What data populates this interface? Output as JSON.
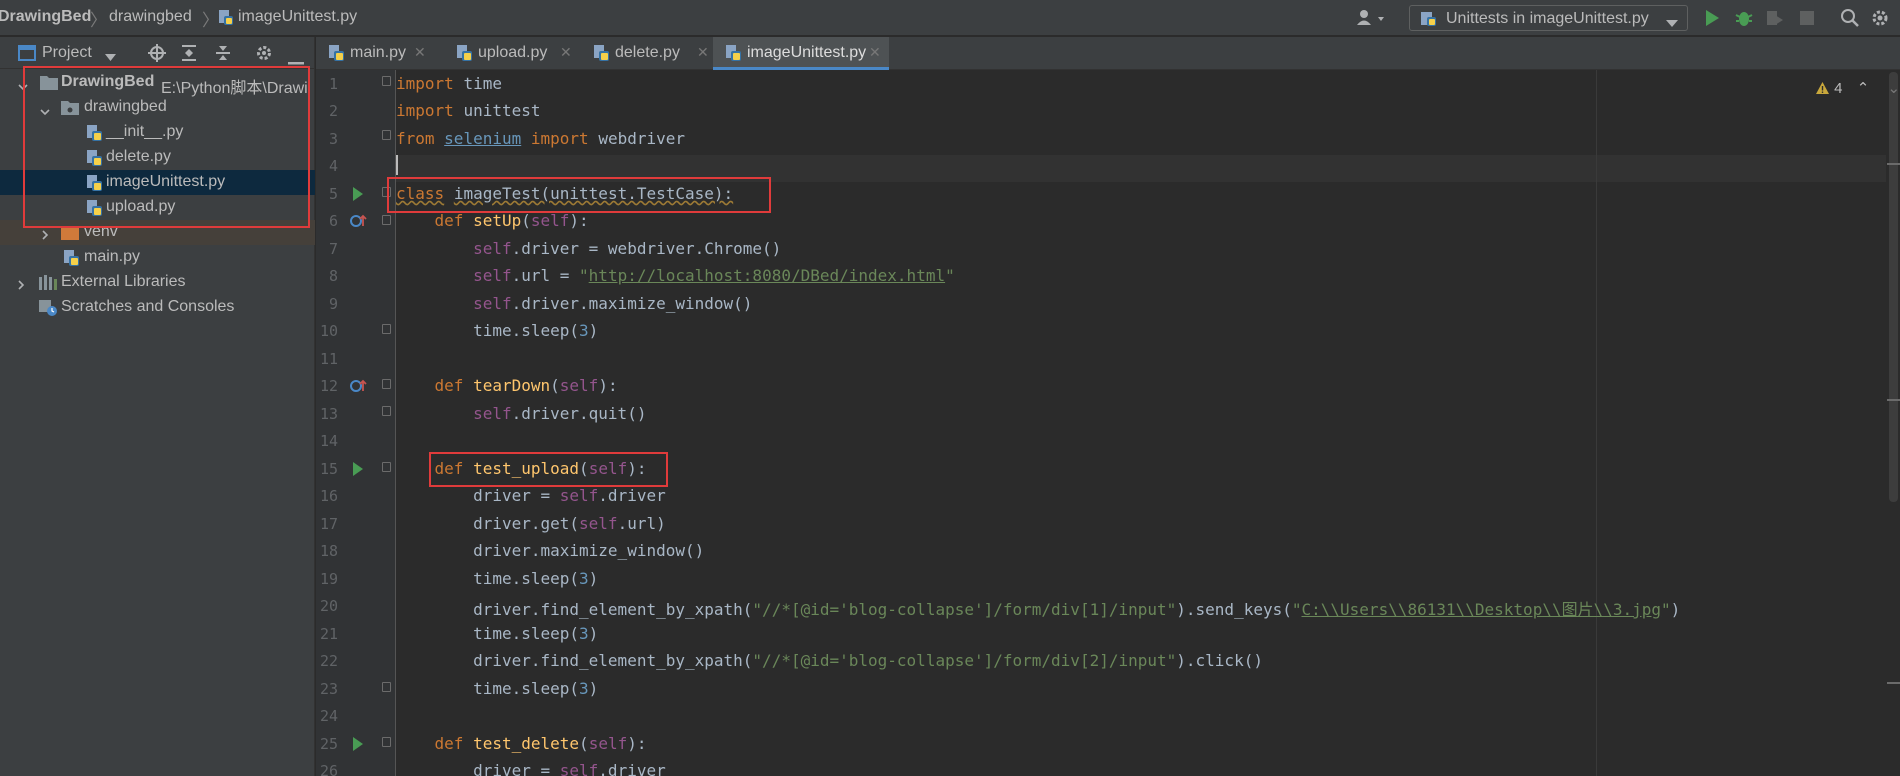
{
  "breadcrumb": {
    "project": "DrawingBed",
    "folder": "drawingbed",
    "file": "imageUnittest.py"
  },
  "run_config": {
    "label": "Unittests in imageUnittest.py"
  },
  "project_panel": {
    "title": "Project",
    "root": {
      "name": "DrawingBed",
      "path": "E:\\Python脚本\\Drawi"
    },
    "items": [
      {
        "label": "drawingbed"
      },
      {
        "label": "__init__.py"
      },
      {
        "label": "delete.py"
      },
      {
        "label": "imageUnittest.py"
      },
      {
        "label": "upload.py"
      },
      {
        "label": "venv"
      },
      {
        "label": "main.py"
      },
      {
        "label": "External Libraries"
      },
      {
        "label": "Scratches and Consoles"
      }
    ]
  },
  "tabs": [
    {
      "label": "main.py"
    },
    {
      "label": "upload.py"
    },
    {
      "label": "delete.py"
    },
    {
      "label": "imageUnittest.py"
    }
  ],
  "editor": {
    "warnings_count": "4",
    "line_numbers": [
      "1",
      "2",
      "3",
      "4",
      "5",
      "6",
      "7",
      "8",
      "9",
      "10",
      "11",
      "12",
      "13",
      "14",
      "15",
      "16",
      "17",
      "18",
      "19",
      "20",
      "21",
      "22",
      "23",
      "24",
      "25",
      "26"
    ],
    "lines": {
      "l1": "import time",
      "l2": "import unittest",
      "l3": "from selenium import webdriver",
      "l5": "class imageTest(unittest.TestCase):",
      "l6": "    def setUp(self):",
      "l7": "        self.driver = webdriver.Chrome()",
      "l8": "        self.url = \"http://localhost:8080/DBed/index.html\"",
      "l9": "        self.driver.maximize_window()",
      "l10": "        time.sleep(3)",
      "l12": "    def tearDown(self):",
      "l13": "        self.driver.quit()",
      "l15": "    def test_upload(self):",
      "l16": "        driver = self.driver",
      "l17": "        driver.get(self.url)",
      "l18": "        driver.maximize_window()",
      "l19": "        time.sleep(3)",
      "l20": "        driver.find_element_by_xpath(\"//*[@id='blog-collapse']/form/div[1]/input\").send_keys(\"C:\\\\Users\\\\86131\\\\Desktop\\\\图片\\\\3.jpg\")",
      "l21": "        time.sleep(3)",
      "l22": "        driver.find_element_by_xpath(\"//*[@id='blog-collapse']/form/div[2]/input\").click()",
      "l23": "        time.sleep(3)",
      "l25": "    def test_delete(self):",
      "l26": "        driver = self.driver"
    },
    "tokens": {
      "kw_import": "import",
      "mod_time": "time",
      "mod_unittest": "unittest",
      "kw_from": "from",
      "mod_selenium": "selenium",
      "mod_webdriver": "webdriver",
      "kw_class": "class",
      "cls_name": "imageTest(unittest.TestCase):",
      "kw_def": "def",
      "fn_setUp": "setUp",
      "fn_tearDown": "tearDown",
      "fn_test_upload": "test_upload",
      "fn_test_delete": "test_delete",
      "self": "self",
      "url_str": "http://localhost:8080/DBed/index.html",
      "xpath1": "\"//*[@id='blog-collapse']/form/div[1]/input\"",
      "xpath2": "\"//*[@id='blog-collapse']/form/div[2]/input\"",
      "path_str": "C:\\\\Users\\\\86131\\\\Desktop\\\\图片\\\\3.jpg",
      "num3": "3"
    }
  },
  "colors": {
    "keyword": "#cc7832",
    "function": "#ffc66d",
    "self": "#94558d",
    "string": "#6a8759",
    "number": "#6897bb",
    "highlight_box": "#e03b3b",
    "run_icon": "#499c54"
  }
}
